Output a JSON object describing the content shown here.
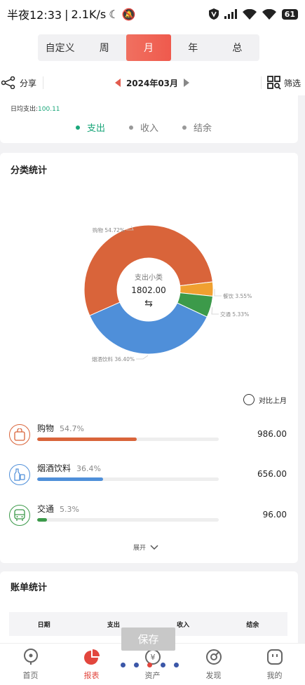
{
  "status": {
    "time": "半夜12:33",
    "speed": "2.1K/s",
    "battery": "61"
  },
  "period_tabs": [
    "自定义",
    "周",
    "月",
    "年",
    "总"
  ],
  "period_active": "月",
  "toolbar": {
    "share_label": "分享",
    "date": "2024年03月",
    "filter_label": "筛选"
  },
  "summary": {
    "avg_label": "日均支出:",
    "avg_value": "100.11",
    "types": [
      "支出",
      "收入",
      "结余"
    ]
  },
  "category": {
    "title": "分类统计",
    "center_label": "支出小类",
    "center_value": "1802.00",
    "center_icon": "swap-icon",
    "compare_label": "对比上月",
    "expand_label": "展开",
    "colors": {
      "shopping": "#d9643a",
      "drinks": "#4f8fd9",
      "transport": "#3c9a4a",
      "dining": "#f0a030"
    }
  },
  "chart_data": {
    "type": "pie",
    "donut": true,
    "slices": [
      {
        "label": "购物",
        "percent": 54.72,
        "label_text": "购物 54.72%",
        "color": "#d9643a"
      },
      {
        "label": "餐饮",
        "percent": 3.55,
        "label_text": "餐饮 3.55%",
        "color": "#f0a030"
      },
      {
        "label": "交通",
        "percent": 5.33,
        "label_text": "交通 5.33%",
        "color": "#3c9a4a"
      },
      {
        "label": "烟酒饮料",
        "percent": 36.4,
        "label_text": "烟酒饮料 36.40%",
        "color": "#4f8fd9"
      }
    ]
  },
  "categories": [
    {
      "name": "购物",
      "pct": "54.7%",
      "pct_value": 54.7,
      "amount": "986.00",
      "color": "#d9643a",
      "icon": "shopping-bag-icon",
      "glyph": "👜"
    },
    {
      "name": "烟酒饮料",
      "pct": "36.4%",
      "pct_value": 36.4,
      "amount": "656.00",
      "color": "#4f8fd9",
      "icon": "bottle-icon",
      "glyph": "🍾"
    },
    {
      "name": "交通",
      "pct": "5.3%",
      "pct_value": 5.3,
      "amount": "96.00",
      "color": "#3c9a4a",
      "icon": "bus-icon",
      "glyph": "🚌"
    }
  ],
  "bill": {
    "title": "账单统计",
    "headers": [
      "日期",
      "支出",
      "收入",
      "结余"
    ]
  },
  "save_label": "保存",
  "nav": [
    {
      "label": "首页",
      "icon": "home-icon"
    },
    {
      "label": "报表",
      "icon": "report-icon"
    },
    {
      "label": "资产",
      "icon": "assets-icon"
    },
    {
      "label": "发现",
      "icon": "discover-icon"
    },
    {
      "label": "我的",
      "icon": "profile-icon"
    }
  ],
  "nav_active": "报表"
}
